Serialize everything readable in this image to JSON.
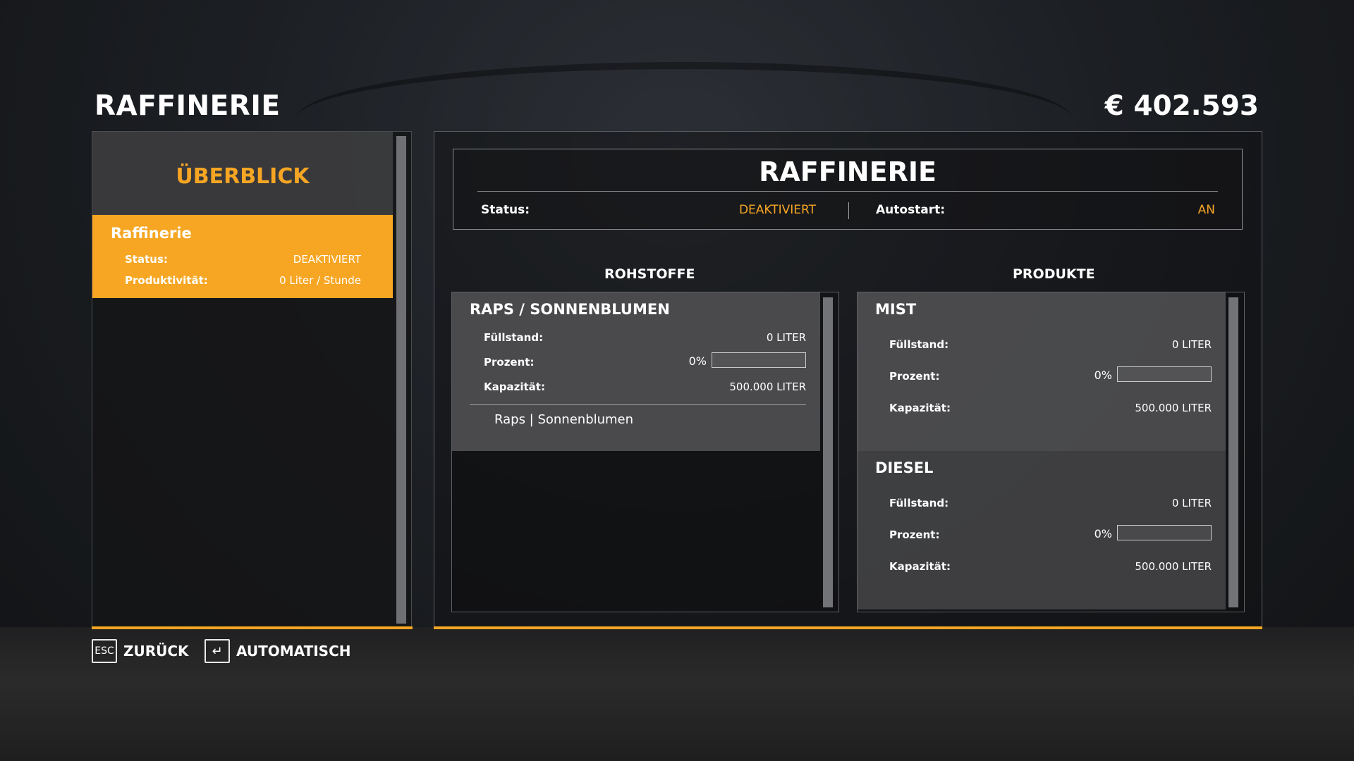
{
  "header": {
    "title": "RAFFINERIE",
    "money": "€ 402.593"
  },
  "sidebar": {
    "title": "ÜBERBLICK",
    "items": [
      {
        "name": "Raffinerie",
        "status_label": "Status:",
        "status_value": "DEAKTIVIERT",
        "productivity_label": "Produktivität:",
        "productivity_value": "0 Liter / Stunde"
      }
    ]
  },
  "detail": {
    "title": "RAFFINERIE",
    "status_label": "Status:",
    "status_value": "DEAKTIVIERT",
    "autostart_label": "Autostart:",
    "autostart_value": "AN"
  },
  "rohstoffe": {
    "heading": "ROHSTOFFE",
    "items": [
      {
        "title": "RAPS / SONNENBLUMEN",
        "fill_label": "Füllstand:",
        "fill_value": "0 LITER",
        "percent_label": "Prozent:",
        "percent_value": "0%",
        "percent": 0,
        "capacity_label": "Kapazität:",
        "capacity_value": "500.000 LITER",
        "ingredients": "Raps | Sonnenblumen"
      }
    ]
  },
  "produkte": {
    "heading": "PRODUKTE",
    "items": [
      {
        "title": "MIST",
        "fill_label": "Füllstand:",
        "fill_value": "0 LITER",
        "percent_label": "Prozent:",
        "percent_value": "0%",
        "percent": 0,
        "capacity_label": "Kapazität:",
        "capacity_value": "500.000 LITER"
      },
      {
        "title": "DIESEL",
        "fill_label": "Füllstand:",
        "fill_value": "0 LITER",
        "percent_label": "Prozent:",
        "percent_value": "0%",
        "percent": 0,
        "capacity_label": "Kapazität:",
        "capacity_value": "500.000 LITER"
      }
    ]
  },
  "footer": {
    "back_key": "ESC",
    "back_label": "ZURÜCK",
    "auto_key": "↵",
    "auto_label": "AUTOMATISCH"
  },
  "colors": {
    "accent": "#f6a623"
  }
}
